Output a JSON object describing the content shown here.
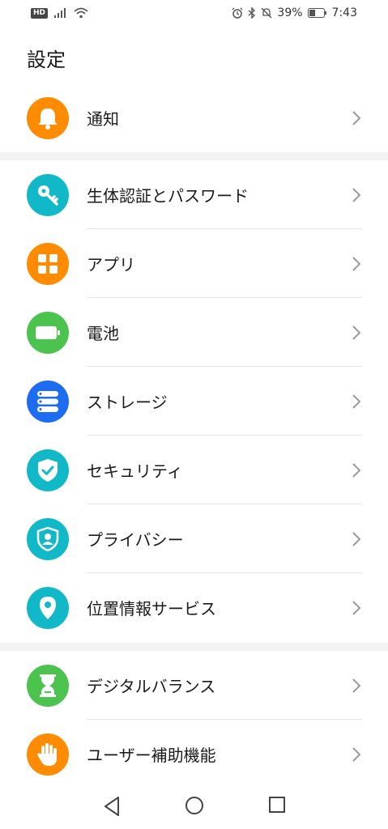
{
  "status_bar": {
    "hd": "HD",
    "battery_percent": "39%",
    "time": "7:43"
  },
  "page": {
    "title": "設定"
  },
  "colors": {
    "orange": "#FF8C00",
    "teal": "#11B8C8",
    "green": "#4CC24F",
    "blue": "#1E6CF0",
    "divider_band": "#f2f2f2"
  },
  "items": [
    {
      "label": "通知",
      "icon": "bell-icon"
    },
    {
      "label": "生体認証とパスワード",
      "icon": "key-icon"
    },
    {
      "label": "アプリ",
      "icon": "apps-grid-icon"
    },
    {
      "label": "電池",
      "icon": "battery-icon"
    },
    {
      "label": "ストレージ",
      "icon": "storage-icon"
    },
    {
      "label": "セキュリティ",
      "icon": "shield-check-icon"
    },
    {
      "label": "プライバシー",
      "icon": "privacy-shield-icon"
    },
    {
      "label": "位置情報サービス",
      "icon": "location-pin-icon"
    },
    {
      "label": "デジタルバランス",
      "icon": "hourglass-icon"
    },
    {
      "label": "ユーザー補助機能",
      "icon": "hand-icon"
    }
  ],
  "nav_bar": {
    "buttons": [
      "back-icon",
      "home-icon",
      "recents-icon"
    ]
  }
}
